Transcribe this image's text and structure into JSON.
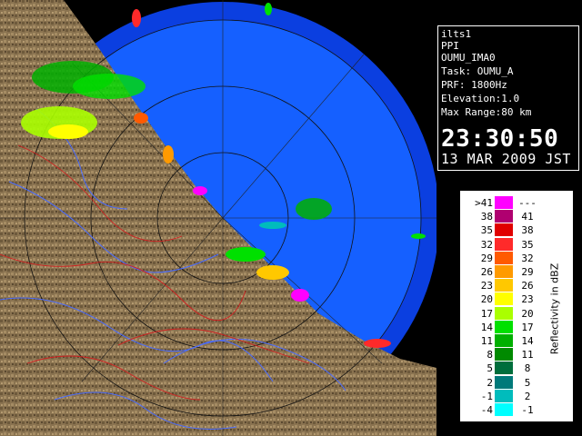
{
  "info": {
    "lines": [
      "ilts1",
      "PPI",
      "OUMU_IMA0",
      "Task: OUMU_A",
      "PRF: 1800Hz",
      "Elevation:1.0",
      "Max Range:80 km"
    ],
    "time": "23:30:50",
    "date": "13 MAR 2009 JST"
  },
  "legend": {
    "title": "Reflectivity in dBZ",
    "rows": [
      {
        "low": ">41",
        "high": "---",
        "color": "#ff00ff"
      },
      {
        "low": "38",
        "high": "41",
        "color": "#b00070"
      },
      {
        "low": "35",
        "high": "38",
        "color": "#e00000"
      },
      {
        "low": "32",
        "high": "35",
        "color": "#ff2a2a"
      },
      {
        "low": "29",
        "high": "32",
        "color": "#ff5a00"
      },
      {
        "low": "26",
        "high": "29",
        "color": "#ff9a00"
      },
      {
        "low": "23",
        "high": "26",
        "color": "#ffc800"
      },
      {
        "low": "20",
        "high": "23",
        "color": "#ffff00"
      },
      {
        "low": "17",
        "high": "20",
        "color": "#aaff00"
      },
      {
        "low": "14",
        "high": "17",
        "color": "#00e000"
      },
      {
        "low": "11",
        "high": "14",
        "color": "#00b000"
      },
      {
        "low": "8",
        "high": "11",
        "color": "#008a00"
      },
      {
        "low": "5",
        "high": "8",
        "color": "#006e3c"
      },
      {
        "low": "2",
        "high": "5",
        "color": "#007a7a"
      },
      {
        "low": "-1",
        "high": "2",
        "color": "#00bcbc"
      },
      {
        "low": "-4",
        "high": "-1",
        "color": "#00ffff"
      }
    ]
  },
  "colors": {
    "sea": "#1560ff",
    "sea_outer": "#0b3fe0",
    "land": "#8a7350",
    "background": "#000000"
  }
}
